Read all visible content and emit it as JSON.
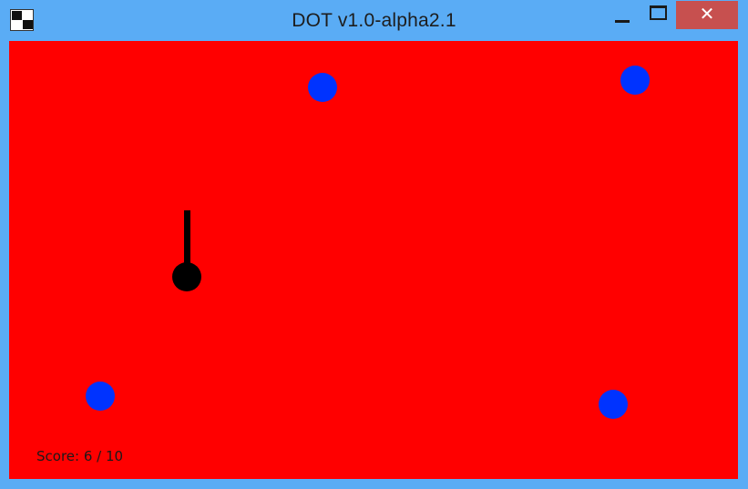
{
  "window": {
    "title": "DOT v1.0-alpha2.1",
    "app_icon": "app-window-icon",
    "controls": {
      "minimize_icon": "minimize-icon",
      "maximize_icon": "maximize-icon",
      "close_icon": "close-icon",
      "close_glyph": "✕"
    },
    "colors": {
      "frame": "#5aacf5",
      "close_button": "#c7504f"
    }
  },
  "game": {
    "background_color": "#ff0000",
    "target_color": "#0033ff",
    "player_color": "#000000",
    "score_label": "Score: 6 / 10"
  }
}
